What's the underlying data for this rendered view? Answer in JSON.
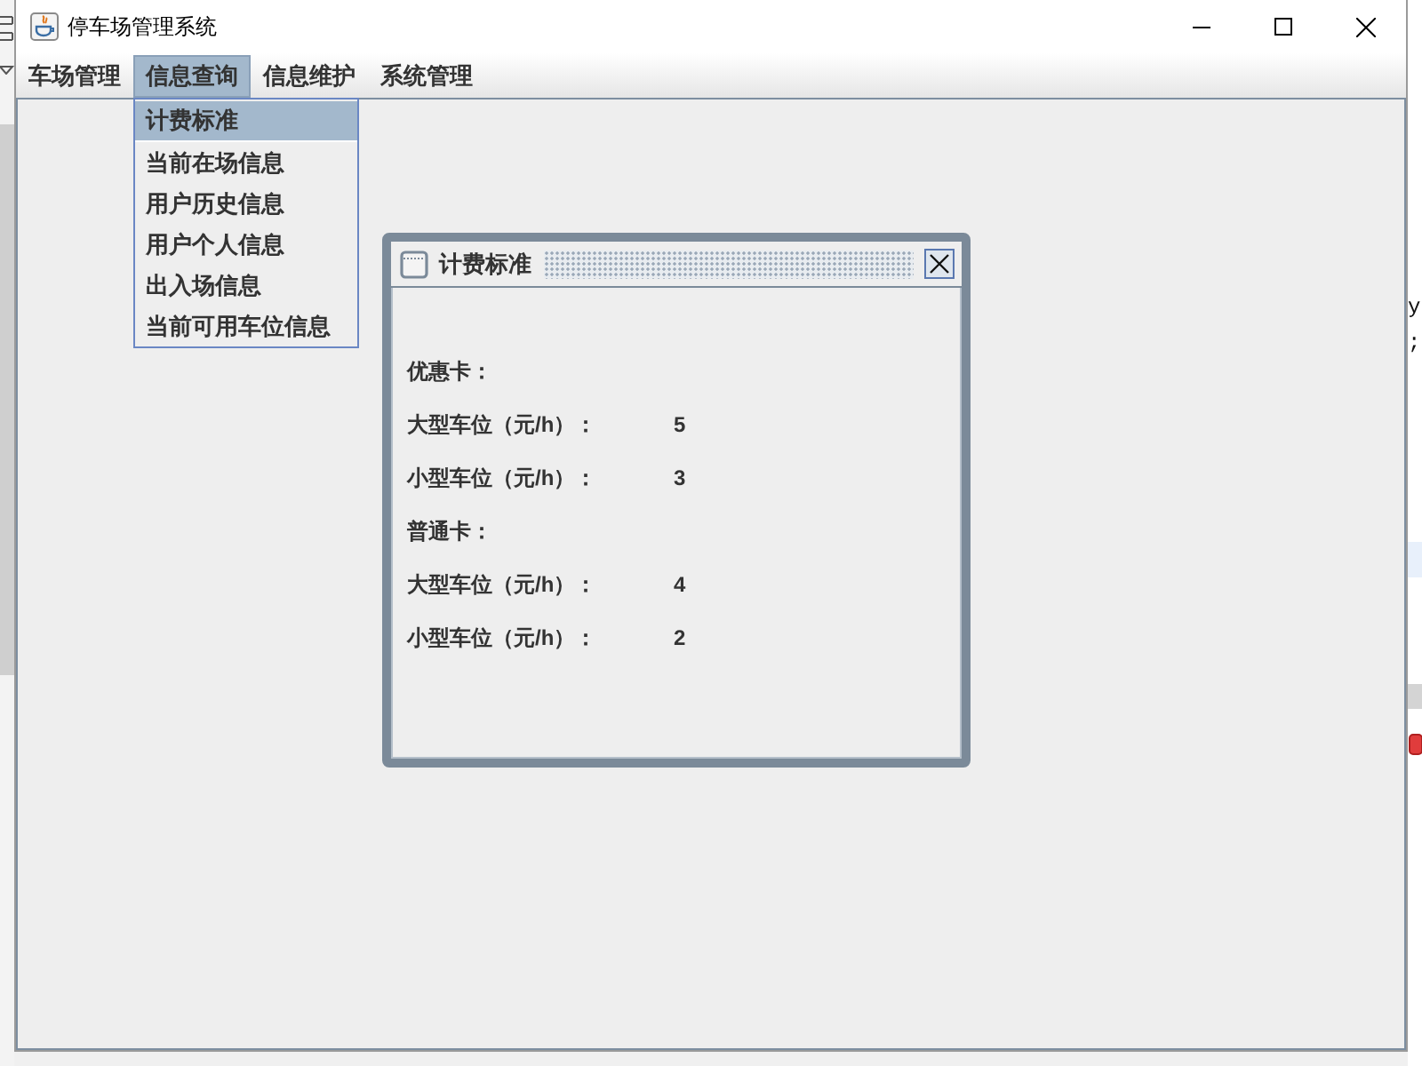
{
  "window": {
    "title": "停车场管理系统"
  },
  "menu_bar": [
    {
      "label": "车场管理",
      "selected": false
    },
    {
      "label": "信息查询",
      "selected": true
    },
    {
      "label": "信息维护",
      "selected": false
    },
    {
      "label": "系统管理",
      "selected": false
    }
  ],
  "dropdown_menu": {
    "items": [
      {
        "label": "计费标准",
        "selected": true
      },
      {
        "label": "当前在场信息",
        "selected": false
      },
      {
        "label": "用户历史信息",
        "selected": false
      },
      {
        "label": "用户个人信息",
        "selected": false
      },
      {
        "label": "出入场信息",
        "selected": false
      },
      {
        "label": "当前可用车位信息",
        "selected": false
      }
    ]
  },
  "internal_frame": {
    "title": "计费标准",
    "rows": [
      {
        "kind": "heading",
        "label": "优惠卡："
      },
      {
        "kind": "rate",
        "label": "大型车位（元/h）：",
        "value": "5"
      },
      {
        "kind": "rate",
        "label": "小型车位（元/h）：",
        "value": "3"
      },
      {
        "kind": "heading",
        "label": "普通卡："
      },
      {
        "kind": "rate",
        "label": "大型车位（元/h）：",
        "value": "4"
      },
      {
        "kind": "rate",
        "label": "小型车位（元/h）：",
        "value": "2"
      }
    ]
  },
  "background_window": {
    "text_fragments": [
      "y",
      ";"
    ]
  }
}
